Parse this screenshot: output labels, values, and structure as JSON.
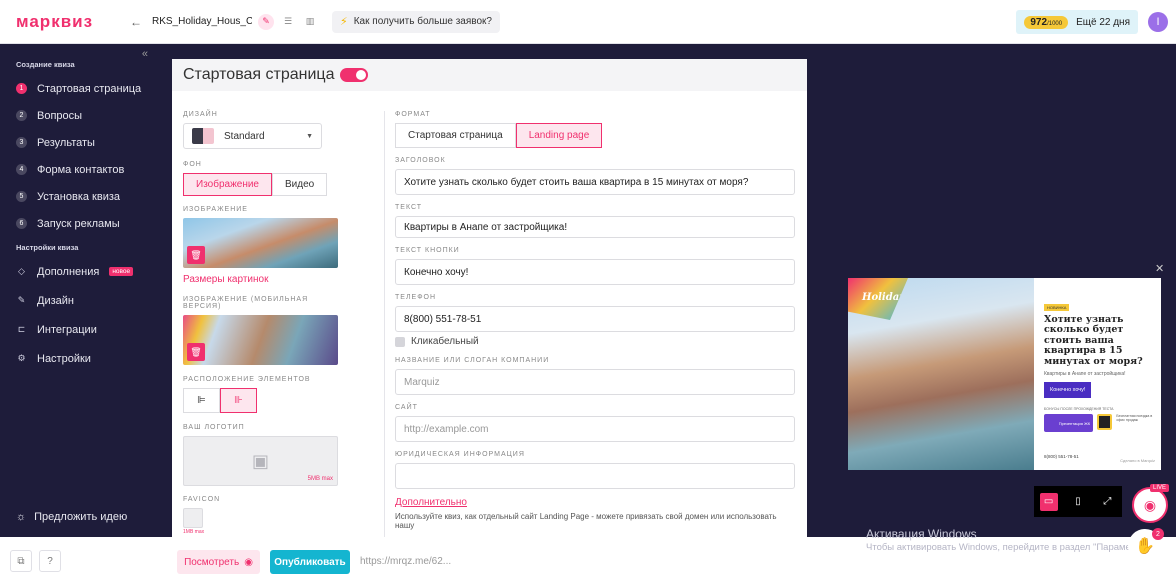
{
  "header": {
    "logo": "марквиз",
    "quiz_name": "RKS_Holiday_Hous_C...",
    "howto": "Как получить больше заявок?",
    "credits": "972",
    "credits_max": "/1000",
    "days_left": "Ещё 22 дня",
    "avatar": "I"
  },
  "sidebar": {
    "section1": "Создание квиза",
    "steps": [
      {
        "num": "1",
        "label": "Стартовая страница"
      },
      {
        "num": "2",
        "label": "Вопросы"
      },
      {
        "num": "3",
        "label": "Результаты"
      },
      {
        "num": "4",
        "label": "Форма контактов"
      },
      {
        "num": "5",
        "label": "Установка квиза"
      },
      {
        "num": "6",
        "label": "Запуск рекламы"
      }
    ],
    "section2": "Настройки квиза",
    "settings": [
      {
        "label": "Дополнения",
        "badge": "новое",
        "icon": "puzzle-icon"
      },
      {
        "label": "Дизайн",
        "icon": "brush-icon"
      },
      {
        "label": "Интеграции",
        "icon": "integration-icon"
      },
      {
        "label": "Настройки",
        "icon": "gear-icon"
      }
    ],
    "suggest": "Предложить идею"
  },
  "panel": {
    "title": "Стартовая страница",
    "design_label": "ДИЗАЙН",
    "design_value": "Standard",
    "bg_label": "ФОН",
    "bg_options": [
      "Изображение",
      "Видео"
    ],
    "image_label": "ИЗОБРАЖЕНИЕ",
    "image_sizes_link": "Размеры картинок",
    "mobile_image_label": "ИЗОБРАЖЕНИЕ (МОБИЛЬНАЯ ВЕРСИЯ)",
    "layout_label": "РАСПОЛОЖЕНИЕ ЭЛЕМЕНТОВ",
    "logo_label": "ВАШ ЛОГОТИП",
    "logo_max": "5MB max",
    "favicon_label": "FAVICON",
    "favicon_max": "1MB max",
    "format_label": "ФОРМАТ",
    "format_options": [
      "Стартовая страница",
      "Landing page"
    ],
    "headline_label": "ЗАГОЛОВОК",
    "headline_value": "Хотите узнать сколько будет стоить ваша квартира в 15 минутах от моря?",
    "text_label": "ТЕКСТ",
    "text_value": "Квартиры в Анапе от застройщика!",
    "button_label": "ТЕКСТ КНОПКИ",
    "button_value": "Конечно хочу!",
    "phone_label": "ТЕЛЕФОН",
    "phone_value": "8(800) 551-78-51",
    "clickable_label": "Кликабельный",
    "company_label": "НАЗВАНИЕ ИЛИ СЛОГАН КОМПАНИИ",
    "company_placeholder": "Marquiz",
    "site_label": "САЙТ",
    "site_placeholder": "http://example.com",
    "legal_label": "ЮРИДИЧЕСКАЯ ИНФОРМАЦИЯ",
    "more_link": "Дополнительно",
    "note": "Используйте квиз, как отдельный сайт Landing Page - можете привязать свой домен или использовать нашу"
  },
  "preview": {
    "logo": "Holiday",
    "tag": "НОВИНКА",
    "title": "Хотите узнать сколько будет стоить ваша квартира в 15 минутах от моря?",
    "subtitle": "Квартиры в Анапе от застройщика!",
    "button": "Конечно хочу!",
    "bonus_label": "БОНУСЫ ПОСЛЕ ПРОХОЖДЕНИЯ ТЕСТА",
    "bonus1": "Презентация ЖК",
    "bonus2": "Бесплатная поездка в офис продаж",
    "phone": "8(800) 551-78-51",
    "footer": "Сделано в Marquiz"
  },
  "bottom": {
    "help": "?",
    "preview_btn": "Посмотреть",
    "publish_btn": "Опубликовать",
    "url": "https://mrqz.me/62...",
    "live": "LIVE",
    "chat_count": "2"
  },
  "windows": {
    "line1": "Активация Windows",
    "line2": "Чтобы активировать Windows, перейдите в раздел \"Параметры\""
  }
}
